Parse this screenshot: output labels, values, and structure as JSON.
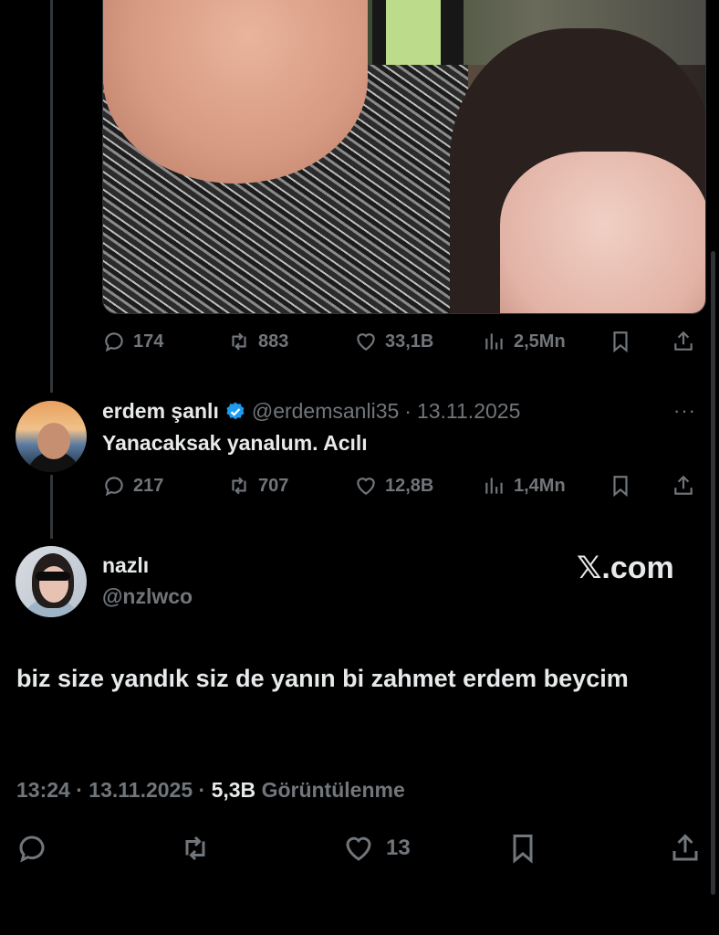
{
  "first_tweet": {
    "photo_alt": "selfie",
    "stats": {
      "replies": "174",
      "retweets": "883",
      "likes": "33,1B",
      "views": "2,5Mn"
    }
  },
  "second_tweet": {
    "display_name": "erdem şanlı",
    "handle": "@erdemsanli35",
    "separator": "·",
    "date": "13.11.2025",
    "more": "···",
    "text": "Yanacaksak yanalum. Acılı",
    "stats": {
      "replies": "217",
      "retweets": "707",
      "likes": "12,8B",
      "views": "1,4Mn"
    }
  },
  "main_tweet": {
    "display_name": "nazlı",
    "handle": "@nzlwco",
    "watermark": "𝕏.com",
    "text": "biz size yandık siz de yanın bi zahmet erdem beycim",
    "time": "13:24",
    "sep1": " · ",
    "date": "13.11.2025",
    "sep2": " · ",
    "views_count": "5,3B",
    "views_label": "Görüntülenme",
    "likes": "13"
  },
  "colors": {
    "background": "#000000",
    "text": "#e7e9ea",
    "muted": "#71767b",
    "verified": "#1d9bf0"
  },
  "icons": [
    "reply-icon",
    "retweet-icon",
    "like-icon",
    "views-icon",
    "bookmark-icon",
    "share-icon",
    "verified-icon"
  ]
}
